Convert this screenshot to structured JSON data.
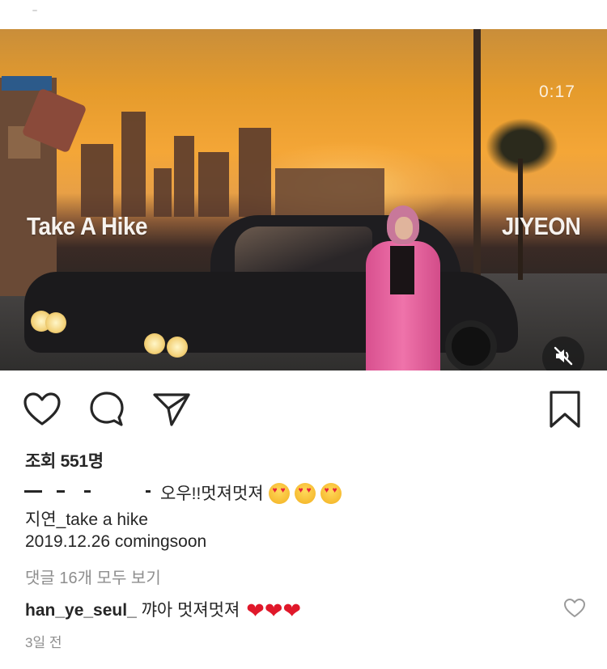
{
  "video": {
    "overlay_title_left": "Take A Hike",
    "overlay_title_right": "JIYEON",
    "timer": "0:17",
    "muted": true,
    "mute_icon": "speaker-muted-icon"
  },
  "actions": {
    "like_icon": "heart-outline-icon",
    "comment_icon": "comment-bubble-icon",
    "share_icon": "paper-plane-icon",
    "save_icon": "bookmark-icon"
  },
  "post": {
    "views": "조회 551명",
    "caption_line1": "오우!!멋져멋져",
    "caption_line2": "지연_take a hike",
    "caption_line3": "2019.12.26 comingsoon",
    "view_all_comments": "댓글 16개 모두 보기"
  },
  "comment": {
    "username": "han_ye_seul_",
    "text": "꺄아 멋져멋져",
    "hearts": "❤❤❤",
    "like_icon": "heart-outline-small-icon"
  },
  "timestamp": "3일 전",
  "colors": {
    "text": "#262626",
    "secondary": "#8e8e8e",
    "heart_red": "#e0182a"
  }
}
